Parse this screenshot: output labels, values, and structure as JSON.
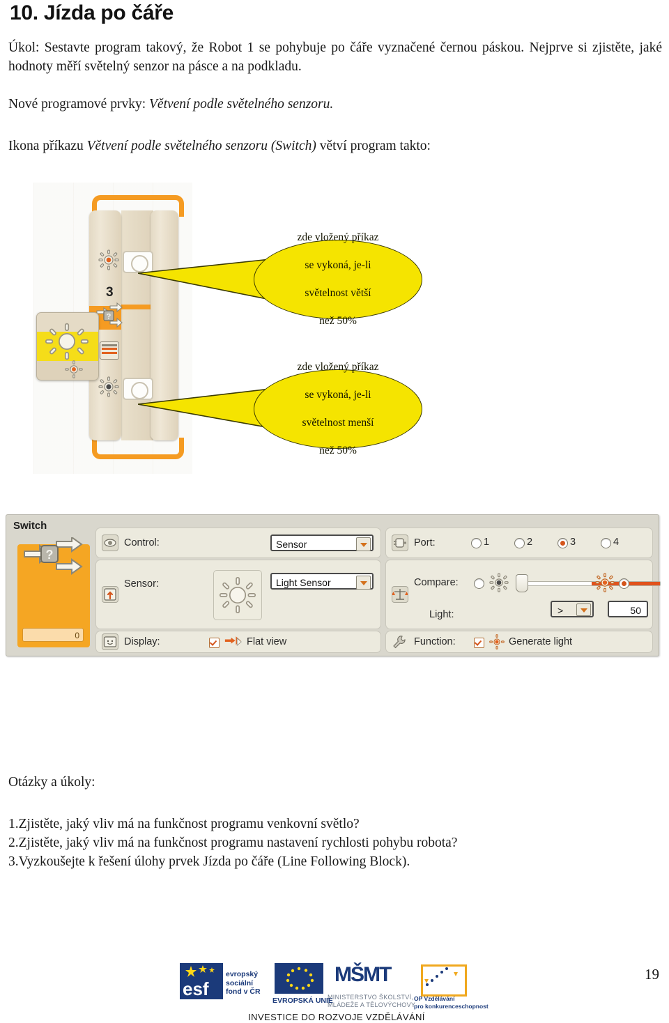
{
  "document": {
    "title": "10. Jízda po čáře",
    "page_number": "19"
  },
  "intro": {
    "task_label": "Úkol:",
    "task_text": "Úkol: Sestavte program takový, že Robot 1 se pohybuje po čáře vyznačené černou páskou. Nejprve si zjistěte, jaké hodnoty měří světelný senzor na pásce a na podkladu.",
    "new_elements_prefix": "Nové programové prvky: ",
    "new_elements_italic": "Větvení podle světelného senzoru.",
    "icon_line_prefix": "Ikona příkazu ",
    "icon_line_italic": "Větvení podle světelného senzoru (Switch)",
    "icon_line_suffix": " větví program takto:"
  },
  "illustration": {
    "port_number_label": "3",
    "callout_top": "zde vložený příkaz se vykoná, je-li světelnost větší než 50%",
    "callout_top_lines": [
      "zde vložený příkaz",
      "se vykoná, je-li",
      "světelnost větší",
      "než 50%"
    ],
    "callout_bottom_lines": [
      "zde vložený příkaz",
      "se vykoná, je-li",
      "světelnost menší",
      "než 50%"
    ]
  },
  "config_panel": {
    "title": "Switch",
    "block_value": "0",
    "rows": {
      "control": {
        "label": "Control:",
        "value": "Sensor"
      },
      "sensor": {
        "label": "Sensor:",
        "value": "Light Sensor"
      },
      "display": {
        "label": "Display:",
        "option": "Flat view",
        "checked": true
      },
      "port": {
        "label": "Port:",
        "options": [
          "1",
          "2",
          "3",
          "4"
        ],
        "selected": "3"
      },
      "compare": {
        "label": "Compare:",
        "light_label": "Light:",
        "operator": ">",
        "threshold": "50",
        "slider_percent": 50
      },
      "function": {
        "label": "Function:",
        "option": "Generate light",
        "checked": true
      }
    }
  },
  "questions": {
    "heading": "Otázky a úkoly:",
    "items": [
      "1.Zjistěte, jaký vliv má na funkčnost programu venkovní světlo?",
      "2.Zjistěte, jaký vliv má na funkčnost programu nastavení rychlosti pohybu robota?",
      "3.Vyzkoušejte k řešení úlohy prvek Jízda po čáře (Line Following Block)."
    ]
  },
  "footer": {
    "esf_lines": "evropský\nsociální\nfond v ČR",
    "esf_line1": "evropský",
    "esf_line2": "sociální",
    "esf_line3": "fond v ČR",
    "eu_label": "EVROPSKÁ UNIE",
    "msmt_mark": "MŠMT",
    "msmt_line1": "MINISTERSTVO ŠKOLSTVÍ,",
    "msmt_line2": "MLÁDEŽE A TĚLOVÝCHOVY",
    "op_line1": "OP Vzdělávání",
    "op_line2": "pro konkurenceschopnost",
    "motto": "INVESTICE DO ROZVOJE VZDĚLÁVÁNÍ"
  },
  "colors": {
    "accent_orange": "#f5a623",
    "balloon_yellow": "#f5e400",
    "eu_blue": "#1b3a7a",
    "slider_orange": "#e1521c"
  }
}
